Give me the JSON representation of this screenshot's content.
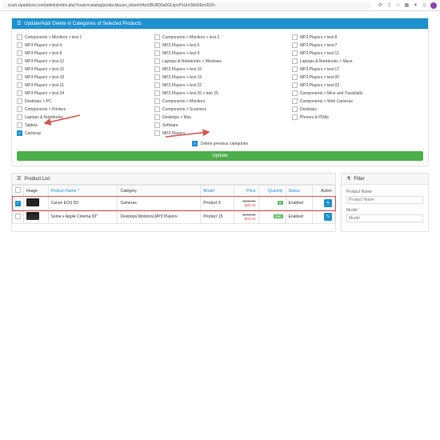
{
  "browser": {
    "url": "xcart.vipaddons.com/admin/index.php?route=catalog/product&user_token=lAnt3BU8D6a0GUgrvPzUnrSIkWEmS02h"
  },
  "panel_title": "Update/Add/ Delete in Categories of Selected Products",
  "categories": {
    "col1": [
      "Components > Monitors > test 1",
      "MP3 Players > test 4",
      "MP3 Players > test 8",
      "MP3 Players > test 12",
      "MP3 Players > test 15",
      "MP3 Players > test 18",
      "MP3 Players > test 21",
      "MP3 Players > test 24",
      "Desktops > PC",
      "Components > Printers",
      "Laptops & Notebooks",
      "Tablets",
      "Cameras"
    ],
    "col2": [
      "Components > Monitors > test 2",
      "MP3 Players > test 5",
      "MP3 Players > test 9",
      "Laptops & Notebooks > Windows",
      "MP3 Players > test 16",
      "MP3 Players > test 19",
      "MP3 Players > test 22",
      "MP3 Players > test 20 > test 25",
      "Components > Monitors",
      "Components > Scanners",
      "Desktops > Mac",
      "Software",
      "MP3 Players"
    ],
    "col3": [
      "MP3 Players > test 8",
      "MP3 Players > test 7",
      "MP3 Players > test 11",
      "Laptops & Notebooks > Macs",
      "MP3 Players > test 17",
      "MP3 Players > test 20",
      "MP3 Players > test 23",
      "Components > Mice and Trackballs",
      "Components > Web Cameras",
      "Desktops",
      "Phones & PDAs"
    ]
  },
  "delete_prev_label": "Delete previous categories",
  "update_btn": "Update",
  "product_list_title": "Product List",
  "filter_title": "Filter",
  "table": {
    "headers": {
      "image": "Image",
      "name": "Product Name",
      "cat": "Category",
      "model": "Model",
      "price": "Price",
      "qty": "Quantity",
      "status": "Status",
      "action": "Action"
    },
    "sort_indicator": "^",
    "rows": [
      {
        "name": "Canon EOS 5D",
        "cat": "Cameras",
        "model": "Product 3",
        "price_strike": "$100.00",
        "price": "$80.00",
        "qty": "5",
        "status": "Enabled"
      },
      {
        "name": "Some e Apple Cinema 30\"",
        "cat": "Desktops,Monitors,MP3 Players",
        "model": "Product 15",
        "price_strike": "$100.00",
        "price": "$90.00",
        "qty": "990",
        "status": "Enabled"
      }
    ]
  },
  "filter": {
    "name_label": "Product Name",
    "name_ph": "Product Name",
    "model_label": "Model",
    "model_ph": "Model"
  }
}
